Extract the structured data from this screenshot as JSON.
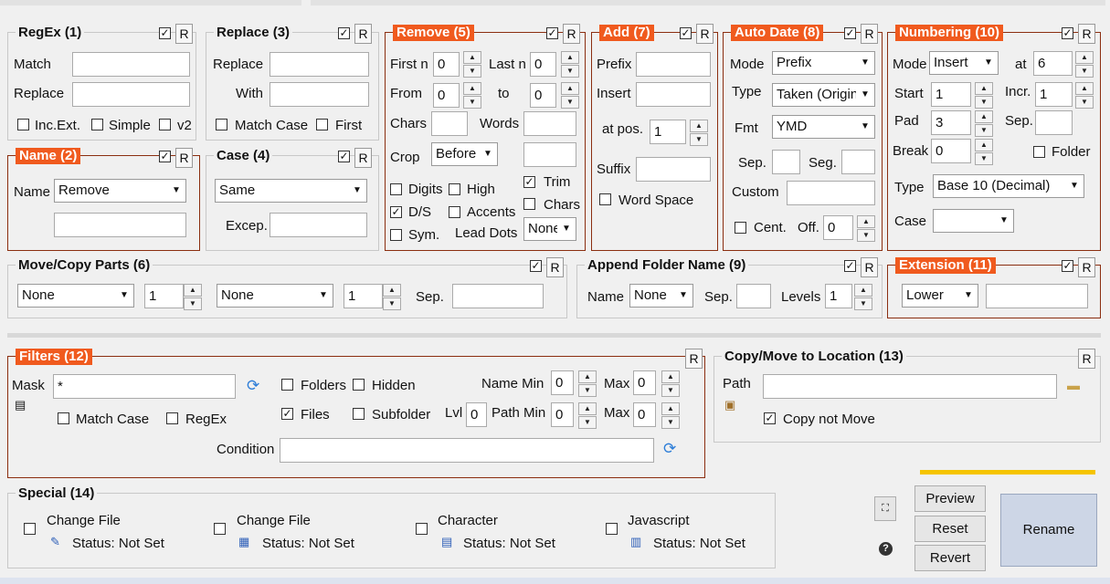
{
  "regex": {
    "title": "RegEx (1)",
    "match_label": "Match",
    "replace_label": "Replace",
    "inc_ext": "Inc.Ext.",
    "simple": "Simple",
    "v2": "v2"
  },
  "replace": {
    "title": "Replace (3)",
    "replace_label": "Replace",
    "with_label": "With",
    "match_case": "Match Case",
    "first": "First"
  },
  "remove": {
    "title": "Remove (5)",
    "first_n": "First n",
    "first_n_val": "0",
    "last_n": "Last n",
    "last_n_val": "0",
    "from": "From",
    "from_val": "0",
    "to": "to",
    "to_val": "0",
    "chars": "Chars",
    "words": "Words",
    "crop": "Crop",
    "crop_val": "Before",
    "trim": "Trim",
    "chars2": "Chars",
    "digits": "Digits",
    "high": "High",
    "ds": "D/S",
    "accents": "Accents",
    "sym": "Sym.",
    "lead_dots": "Lead Dots",
    "lead_val": "None"
  },
  "add": {
    "title": "Add (7)",
    "prefix": "Prefix",
    "insert": "Insert",
    "at_pos": "at pos.",
    "at_pos_val": "1",
    "suffix": "Suffix",
    "word_space": "Word Space"
  },
  "autodate": {
    "title": "Auto Date (8)",
    "mode": "Mode",
    "mode_val": "Prefix",
    "type": "Type",
    "type_val": "Taken (Origin",
    "fmt": "Fmt",
    "fmt_val": "YMD",
    "sep": "Sep.",
    "seg": "Seg.",
    "custom": "Custom",
    "cent": "Cent.",
    "off": "Off.",
    "off_val": "0"
  },
  "numbering": {
    "title": "Numbering (10)",
    "mode": "Mode",
    "mode_val": "Insert",
    "at": "at",
    "at_val": "6",
    "start": "Start",
    "start_val": "1",
    "incr": "Incr.",
    "incr_val": "1",
    "pad": "Pad",
    "pad_val": "3",
    "sep": "Sep.",
    "break": "Break",
    "break_val": "0",
    "folder": "Folder",
    "type": "Type",
    "type_val": "Base 10 (Decimal)",
    "case": "Case"
  },
  "name": {
    "title": "Name (2)",
    "name_label": "Name",
    "name_val": "Remove"
  },
  "case": {
    "title": "Case (4)",
    "case_val": "Same",
    "excep": "Excep."
  },
  "movecopy": {
    "title": "Move/Copy Parts (6)",
    "sel1": "None",
    "num1": "1",
    "sel2": "None",
    "num2": "1",
    "sep": "Sep."
  },
  "appendfolder": {
    "title": "Append Folder Name (9)",
    "name": "Name",
    "name_val": "None",
    "sep": "Sep.",
    "levels": "Levels",
    "levels_val": "1"
  },
  "extension": {
    "title": "Extension (11)",
    "val": "Lower"
  },
  "filters": {
    "title": "Filters (12)",
    "mask": "Mask",
    "mask_val": "*",
    "folders": "Folders",
    "hidden": "Hidden",
    "files": "Files",
    "subfolder": "Subfolder",
    "name_min": "Name Min",
    "name_min_val": "0",
    "max": "Max",
    "max_val": "0",
    "lvl": "Lvl",
    "lvl_val": "0",
    "path_min": "Path Min",
    "path_min_val": "0",
    "max2": "Max",
    "max2_val": "0",
    "match_case": "Match Case",
    "regex": "RegEx",
    "condition": "Condition"
  },
  "copymove": {
    "title": "Copy/Move to Location (13)",
    "path": "Path",
    "copy_not_move": "Copy not Move"
  },
  "special": {
    "title": "Special (14)",
    "items": [
      {
        "label": "Change File",
        "status": "Status: Not Set"
      },
      {
        "label": "Change File",
        "status": "Status: Not Set"
      },
      {
        "label": "Character",
        "status": "Status: Not Set"
      },
      {
        "label": "Javascript",
        "status": "Status: Not Set"
      }
    ]
  },
  "buttons": {
    "preview": "Preview",
    "reset": "Reset",
    "revert": "Revert",
    "rename": "Rename"
  },
  "r_label": "R",
  "check": "✓",
  "colors": {
    "accent": "#f05a1e",
    "rename_bg": "#cdd6e6",
    "progress": "#f5c400"
  }
}
